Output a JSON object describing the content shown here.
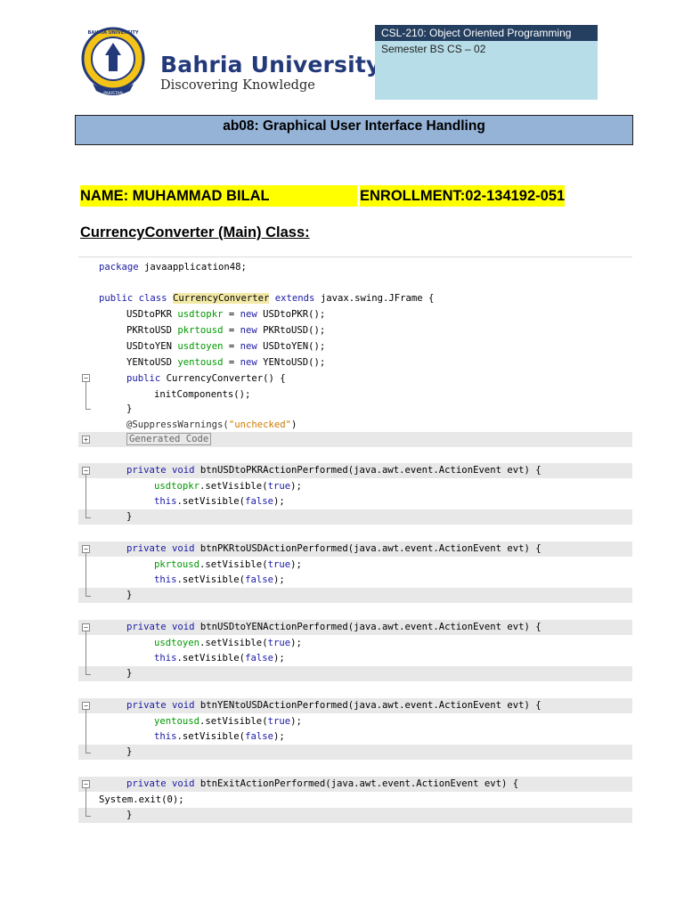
{
  "header": {
    "university_name": "Bahria University",
    "tagline": "Discovering Knowledge",
    "seal_text_top": "BAHRIA UNIVERSITY",
    "seal_text_bottom": "PAKISTAN"
  },
  "course": {
    "code_title": "CSL-210: Object Oriented Programming",
    "semester": "Semester BS CS – 02"
  },
  "lab_title": "ab08: Graphical User Interface Handling",
  "student": {
    "name": "NAME: MUHAMMAD BILAL",
    "enrollment": "ENROLLMENT:02-134192-051"
  },
  "section_heading": "CurrencyConverter (Main) Class:",
  "code": {
    "l1": {
      "kw": "package",
      "rest": " javaapplication48;"
    },
    "l2": {
      "kw1": "public",
      "kw2": "class",
      "cls": "CurrencyConverter",
      "kw3": "extends",
      "rest": " javax.swing.JFrame {"
    },
    "l3": {
      "type": "USDtoPKR",
      "var": "usdtopkr",
      "op": " = ",
      "kw": "new",
      "rest": " USDtoPKR();"
    },
    "l4": {
      "type": "PKRtoUSD",
      "var": "pkrtousd",
      "op": " = ",
      "kw": "new",
      "rest": " PKRtoUSD();"
    },
    "l5": {
      "type": "USDtoYEN",
      "var": "usdtoyen",
      "op": " = ",
      "kw": "new",
      "rest": " USDtoYEN();"
    },
    "l6": {
      "type": "YENtoUSD",
      "var": "yentousd",
      "op": " = ",
      "kw": "new",
      "rest": " YENtoUSD();"
    },
    "l7": {
      "kw": "public",
      "rest": " CurrencyConverter() {"
    },
    "l8": {
      "text": "initComponents();"
    },
    "l9": {
      "text": "}"
    },
    "l10": {
      "ann": "@SuppressWarnings(",
      "str": "\"unchecked\"",
      "close": ")"
    },
    "l11": {
      "text": "Generated Code"
    },
    "m1": {
      "kw": "private void",
      "rest": " btnUSDtoPKRActionPerformed(java.awt.event.ActionEvent evt) {",
      "field": "usdtopkr",
      "call1": ".setVisible(",
      "true": "true",
      "close": ");",
      "this": "this",
      "call2": ".setVisible(",
      "false": "false",
      "end": "}"
    },
    "m2": {
      "kw": "private void",
      "rest": " btnPKRtoUSDActionPerformed(java.awt.event.ActionEvent evt) {",
      "field": "pkrtousd",
      "call1": ".setVisible(",
      "true": "true",
      "close": ");",
      "this": "this",
      "call2": ".setVisible(",
      "false": "false",
      "end": "}"
    },
    "m3": {
      "kw": "private void",
      "rest": " btnUSDtoYENActionPerformed(java.awt.event.ActionEvent evt) {",
      "field": "usdtoyen",
      "call1": ".setVisible(",
      "true": "true",
      "close": ");",
      "this": "this",
      "call2": ".setVisible(",
      "false": "false",
      "end": "}"
    },
    "m4": {
      "kw": "private void",
      "rest": " btnYENtoUSDActionPerformed(java.awt.event.ActionEvent evt) {",
      "field": "yentousd",
      "call1": ".setVisible(",
      "true": "true",
      "close": ");",
      "this": "this",
      "call2": ".setVisible(",
      "false": "false",
      "end": "}"
    },
    "m5": {
      "kw": "private void",
      "rest": " btnExitActionPerformed(java.awt.event.ActionEvent evt) {",
      "body": "System.exit(0);",
      "end": "}"
    }
  },
  "colors": {
    "course_header_bg": "#243f60",
    "course_box_bg": "#b7dde8",
    "lab_band_bg": "#95b3d7",
    "highlight": "#ffff00",
    "keyword": "#1a1aa6",
    "field": "#009900",
    "string": "#ce7b00"
  }
}
